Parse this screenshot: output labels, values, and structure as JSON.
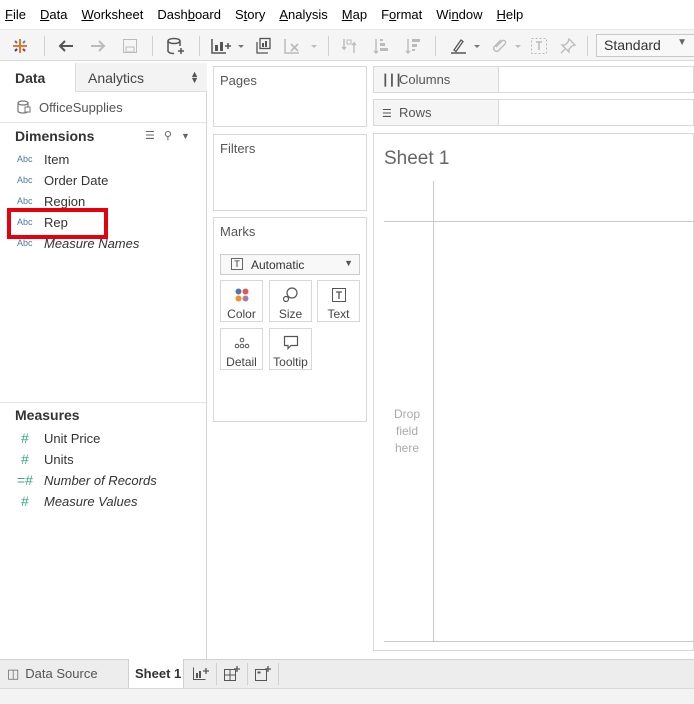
{
  "menu": [
    {
      "pre": "",
      "u": "F",
      "post": "ile"
    },
    {
      "pre": "",
      "u": "D",
      "post": "ata"
    },
    {
      "pre": "",
      "u": "W",
      "post": "orksheet"
    },
    {
      "pre": "Dash",
      "u": "b",
      "post": "oard"
    },
    {
      "pre": "S",
      "u": "t",
      "post": "ory"
    },
    {
      "pre": "",
      "u": "A",
      "post": "nalysis"
    },
    {
      "pre": "",
      "u": "M",
      "post": "ap"
    },
    {
      "pre": "F",
      "u": "o",
      "post": "rmat"
    },
    {
      "pre": "Wi",
      "u": "n",
      "post": "dow"
    },
    {
      "pre": "",
      "u": "H",
      "post": "elp"
    }
  ],
  "toolbar": {
    "fit_value": "Standard",
    "icons": [
      "tableau-logo-icon",
      "back-arrow-icon",
      "forward-arrow-icon",
      "save-icon",
      "new-datasource-icon",
      "new-worksheet-icon",
      "duplicate-sheet-icon",
      "clear-sheet-icon",
      "swap-icon",
      "sort-ascending-icon",
      "sort-descending-icon",
      "highlight-icon",
      "group-icon",
      "labels-icon",
      "pin-icon"
    ]
  },
  "datapane": {
    "tab_data": "Data",
    "tab_analytics": "Analytics",
    "datasource_name": "OfficeSupplies",
    "dimensions_header": "Dimensions",
    "dimensions": [
      {
        "type": "Abc",
        "name": "Item",
        "italic": false
      },
      {
        "type": "Abc",
        "name": "Order Date",
        "italic": false
      },
      {
        "type": "Abc",
        "name": "Region",
        "italic": false
      },
      {
        "type": "Abc",
        "name": "Rep",
        "italic": false
      },
      {
        "type": "Abc",
        "name": "Measure Names",
        "italic": true
      }
    ],
    "measures_header": "Measures",
    "measures": [
      {
        "type": "#",
        "name": "Unit Price",
        "italic": false
      },
      {
        "type": "#",
        "name": "Units",
        "italic": false
      },
      {
        "type": "=#",
        "name": "Number of Records",
        "italic": true
      },
      {
        "type": "#",
        "name": "Measure Values",
        "italic": true
      }
    ],
    "highlight_color": "#e4000d"
  },
  "cards": {
    "pages": "Pages",
    "filters": "Filters",
    "marks": "Marks",
    "marks_type": "Automatic",
    "mark_buttons": [
      {
        "label": "Color",
        "icon": "color-dots-icon"
      },
      {
        "label": "Size",
        "icon": "size-icon"
      },
      {
        "label": "Text",
        "icon": "text-icon"
      },
      {
        "label": "Detail",
        "icon": "detail-dots-icon"
      },
      {
        "label": "Tooltip",
        "icon": "tooltip-icon"
      }
    ]
  },
  "shelves": {
    "columns": "Columns",
    "rows": "Rows"
  },
  "sheet": {
    "title": "Sheet 1",
    "drop_hint": "Drop field here"
  },
  "bottom": {
    "data_source": "Data Source",
    "sheet1": "Sheet 1"
  }
}
